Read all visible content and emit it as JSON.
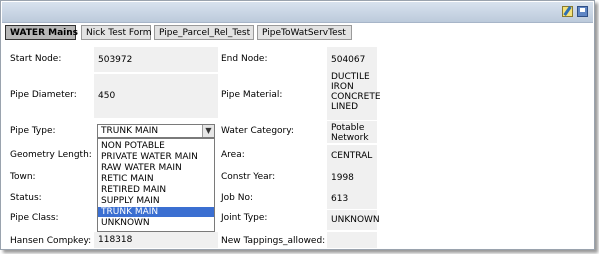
{
  "tabs": [
    "WATER Mains",
    "Nick Test Form",
    "Pipe_Parcel_Rel_Test",
    "PipeToWatServTest"
  ],
  "fields": {
    "start_node": {
      "label": "Start Node:",
      "value": "503972"
    },
    "end_node": {
      "label": "End Node:",
      "value": "504067"
    },
    "pipe_diameter": {
      "label": "Pipe Diameter:",
      "value": "450"
    },
    "pipe_material": {
      "label": "Pipe Material:",
      "lines": [
        "DUCTILE",
        "IRON",
        "CONCRETE",
        "LINED"
      ]
    },
    "pipe_type": {
      "label": "Pipe Type:",
      "value": "TRUNK MAIN"
    },
    "water_category": {
      "label": "Water Category:",
      "lines": [
        "Potable",
        "Network"
      ]
    },
    "geometry_length": {
      "label": "Geometry Length:"
    },
    "area": {
      "label": "Area:",
      "value": "CENTRAL"
    },
    "town": {
      "label": "Town:"
    },
    "constr_year": {
      "label": "Constr Year:",
      "value": "1998"
    },
    "status": {
      "label": "Status:"
    },
    "job_no": {
      "label": "Job No:",
      "value": "613"
    },
    "pipe_class": {
      "label": "Pipe Class:"
    },
    "joint_type": {
      "label": "Joint Type:",
      "value": "UNKNOWN"
    },
    "hansen_compkey": {
      "label": "Hansen Compkey:",
      "value": "118318"
    },
    "new_tappings": {
      "label": "New Tappings_allowed:",
      "value": ""
    }
  },
  "pipe_type_options": [
    "NON POTABLE",
    "PRIVATE WATER MAIN",
    "RAW WATER MAIN",
    "RETIC MAIN",
    "RETIRED MAIN",
    "SUPPLY MAIN",
    "TRUNK MAIN",
    "UNKNOWN"
  ],
  "selected_option_index": 6,
  "colors": {
    "accent_selected": "#3b6fd1",
    "titlebar": "#c9d5e5",
    "value_bg": "#f0f0f0"
  },
  "icons": [
    "edit-icon",
    "save-icon",
    "chevron-down-icon"
  ]
}
